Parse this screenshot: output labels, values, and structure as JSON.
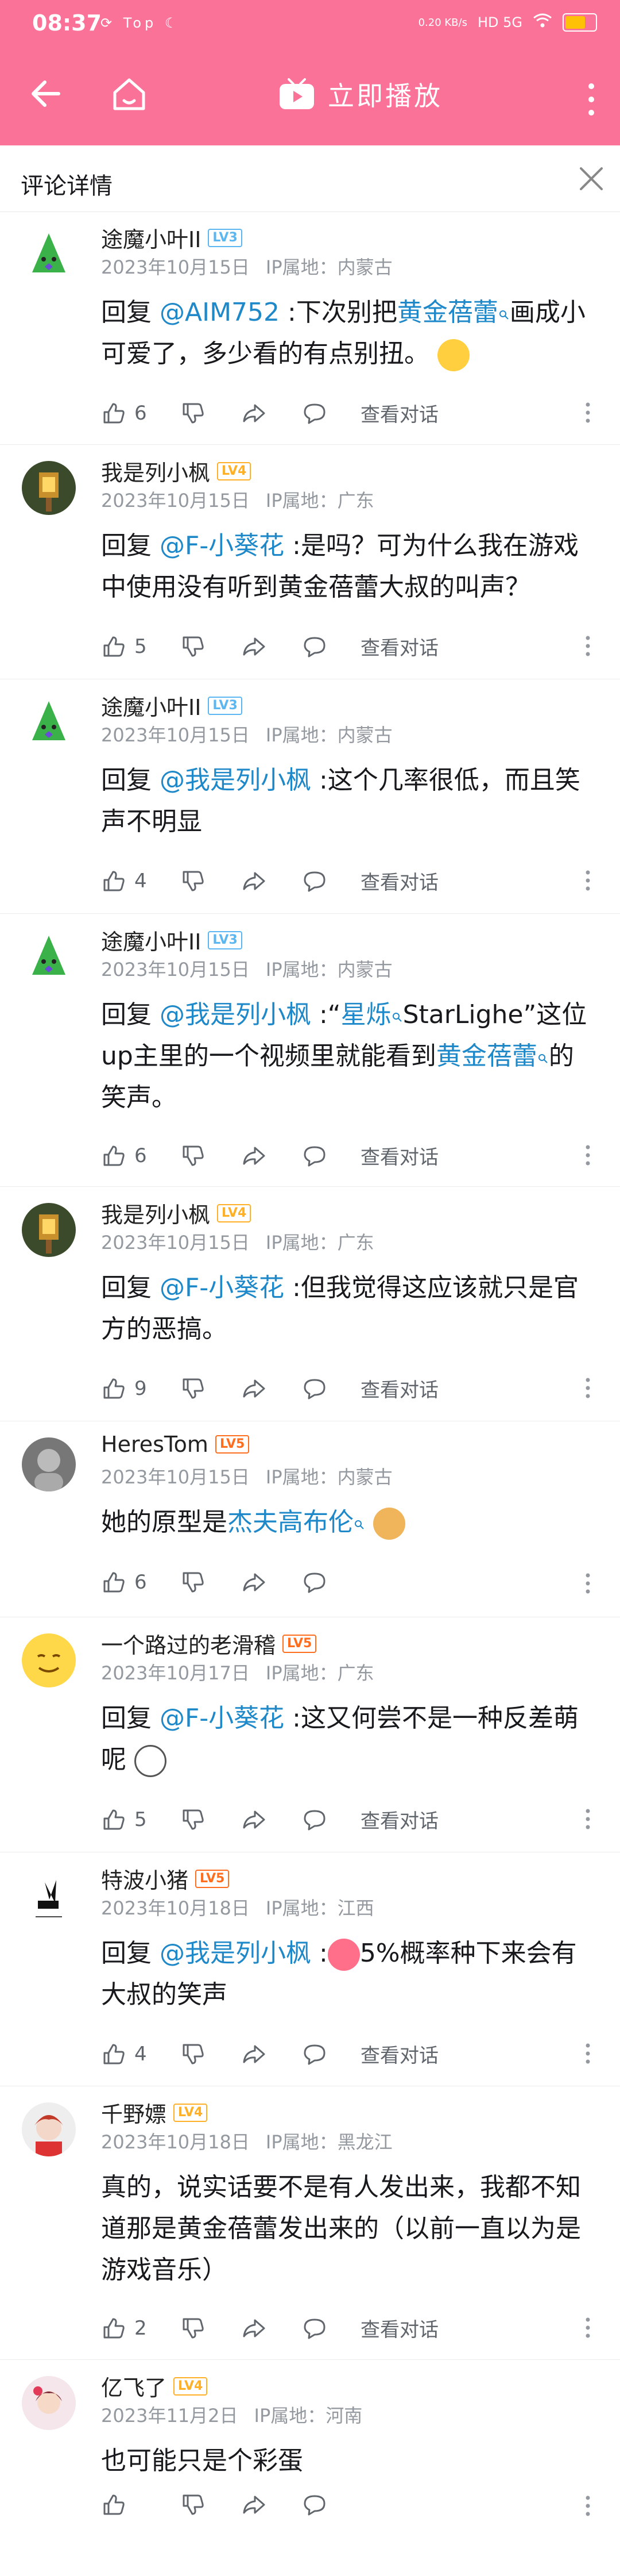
{
  "status_bar": {
    "time": "08:37",
    "icons": "⟳ Top ☾",
    "net_speed": "0.20 KB/s",
    "signal": "HD 5G",
    "battery_label": ""
  },
  "app_bar": {
    "play_label": "立即播放"
  },
  "sub_header": {
    "title": "评论详情"
  },
  "actions": {
    "view_conversation": "查看对话"
  },
  "comments": [
    {
      "username": "途魔小叶II",
      "level": "LV3",
      "date": "2023年10月15日",
      "ip": "IP属地：内蒙古",
      "reply_prefix": "回复 ",
      "mention": "@AIM752",
      "text_a": " :下次别把",
      "link": "黄金蓓蕾",
      "text_b": "画成小可爱了，多少看的有点别扭。",
      "likes": "6"
    },
    {
      "username": "我是列小枫",
      "level": "LV4",
      "date": "2023年10月15日",
      "ip": "IP属地：广东",
      "reply_prefix": "回复 ",
      "mention": "@F-小葵花",
      "text_a": " :是吗？可为什么我在游戏中使用没有听到黄金蓓蕾大叔的叫声？",
      "likes": "5"
    },
    {
      "username": "途魔小叶II",
      "level": "LV3",
      "date": "2023年10月15日",
      "ip": "IP属地：内蒙古",
      "reply_prefix": "回复 ",
      "mention": "@我是列小枫",
      "text_a": " :这个几率很低，而且笑声不明显",
      "likes": "4"
    },
    {
      "username": "途魔小叶II",
      "level": "LV3",
      "date": "2023年10月15日",
      "ip": "IP属地：内蒙古",
      "reply_prefix": "回复 ",
      "mention": "@我是列小枫",
      "text_a": " :“",
      "link": "星烁",
      "text_b": "StarLighe”这位up主里的一个视频里就能看到",
      "link2": "黄金蓓蕾",
      "text_c": "的笑声。",
      "likes": "6"
    },
    {
      "username": "我是列小枫",
      "level": "LV4",
      "date": "2023年10月15日",
      "ip": "IP属地：广东",
      "reply_prefix": "回复 ",
      "mention": "@F-小葵花",
      "text_a": " :但我觉得这应该就只是官方的恶搞。",
      "likes": "9"
    },
    {
      "username": "HeresTom",
      "level": "LV5",
      "date": "2023年10月15日",
      "ip": "IP属地：内蒙古",
      "text_a": "她的原型是",
      "link": "杰夫高布伦",
      "likes": "6"
    },
    {
      "username": "一个路过的老滑稽",
      "level": "LV5",
      "date": "2023年10月17日",
      "ip": "IP属地：广东",
      "reply_prefix": "回复 ",
      "mention": "@F-小葵花",
      "text_a": " :这又何尝不是一种反差萌呢",
      "likes": "5"
    },
    {
      "username": "特波小猪",
      "level": "LV5",
      "date": "2023年10月18日",
      "ip": "IP属地：江西",
      "reply_prefix": "回复 ",
      "mention": "@我是列小枫",
      "text_a": " :",
      "text_b": "5%概率种下来会有大叔的笑声",
      "likes": "4"
    },
    {
      "username": "千野嫖",
      "level": "LV4",
      "date": "2023年10月18日",
      "ip": "IP属地：黑龙江",
      "text_a": "真的，说实话要不是有人发出来，我都不知道那是黄金蓓蕾发出来的（以前一直以为是游戏音乐）",
      "likes": "2"
    },
    {
      "username": "亿飞了",
      "level": "LV4",
      "date": "2023年11月2日",
      "ip": "IP属地：河南",
      "text_a": "也可能只是个彩蛋",
      "likes": ""
    }
  ],
  "colors": {
    "brand_pink": "#fb7299",
    "mention_blue": "#1e88c8",
    "meta_gray": "#9499a0"
  }
}
